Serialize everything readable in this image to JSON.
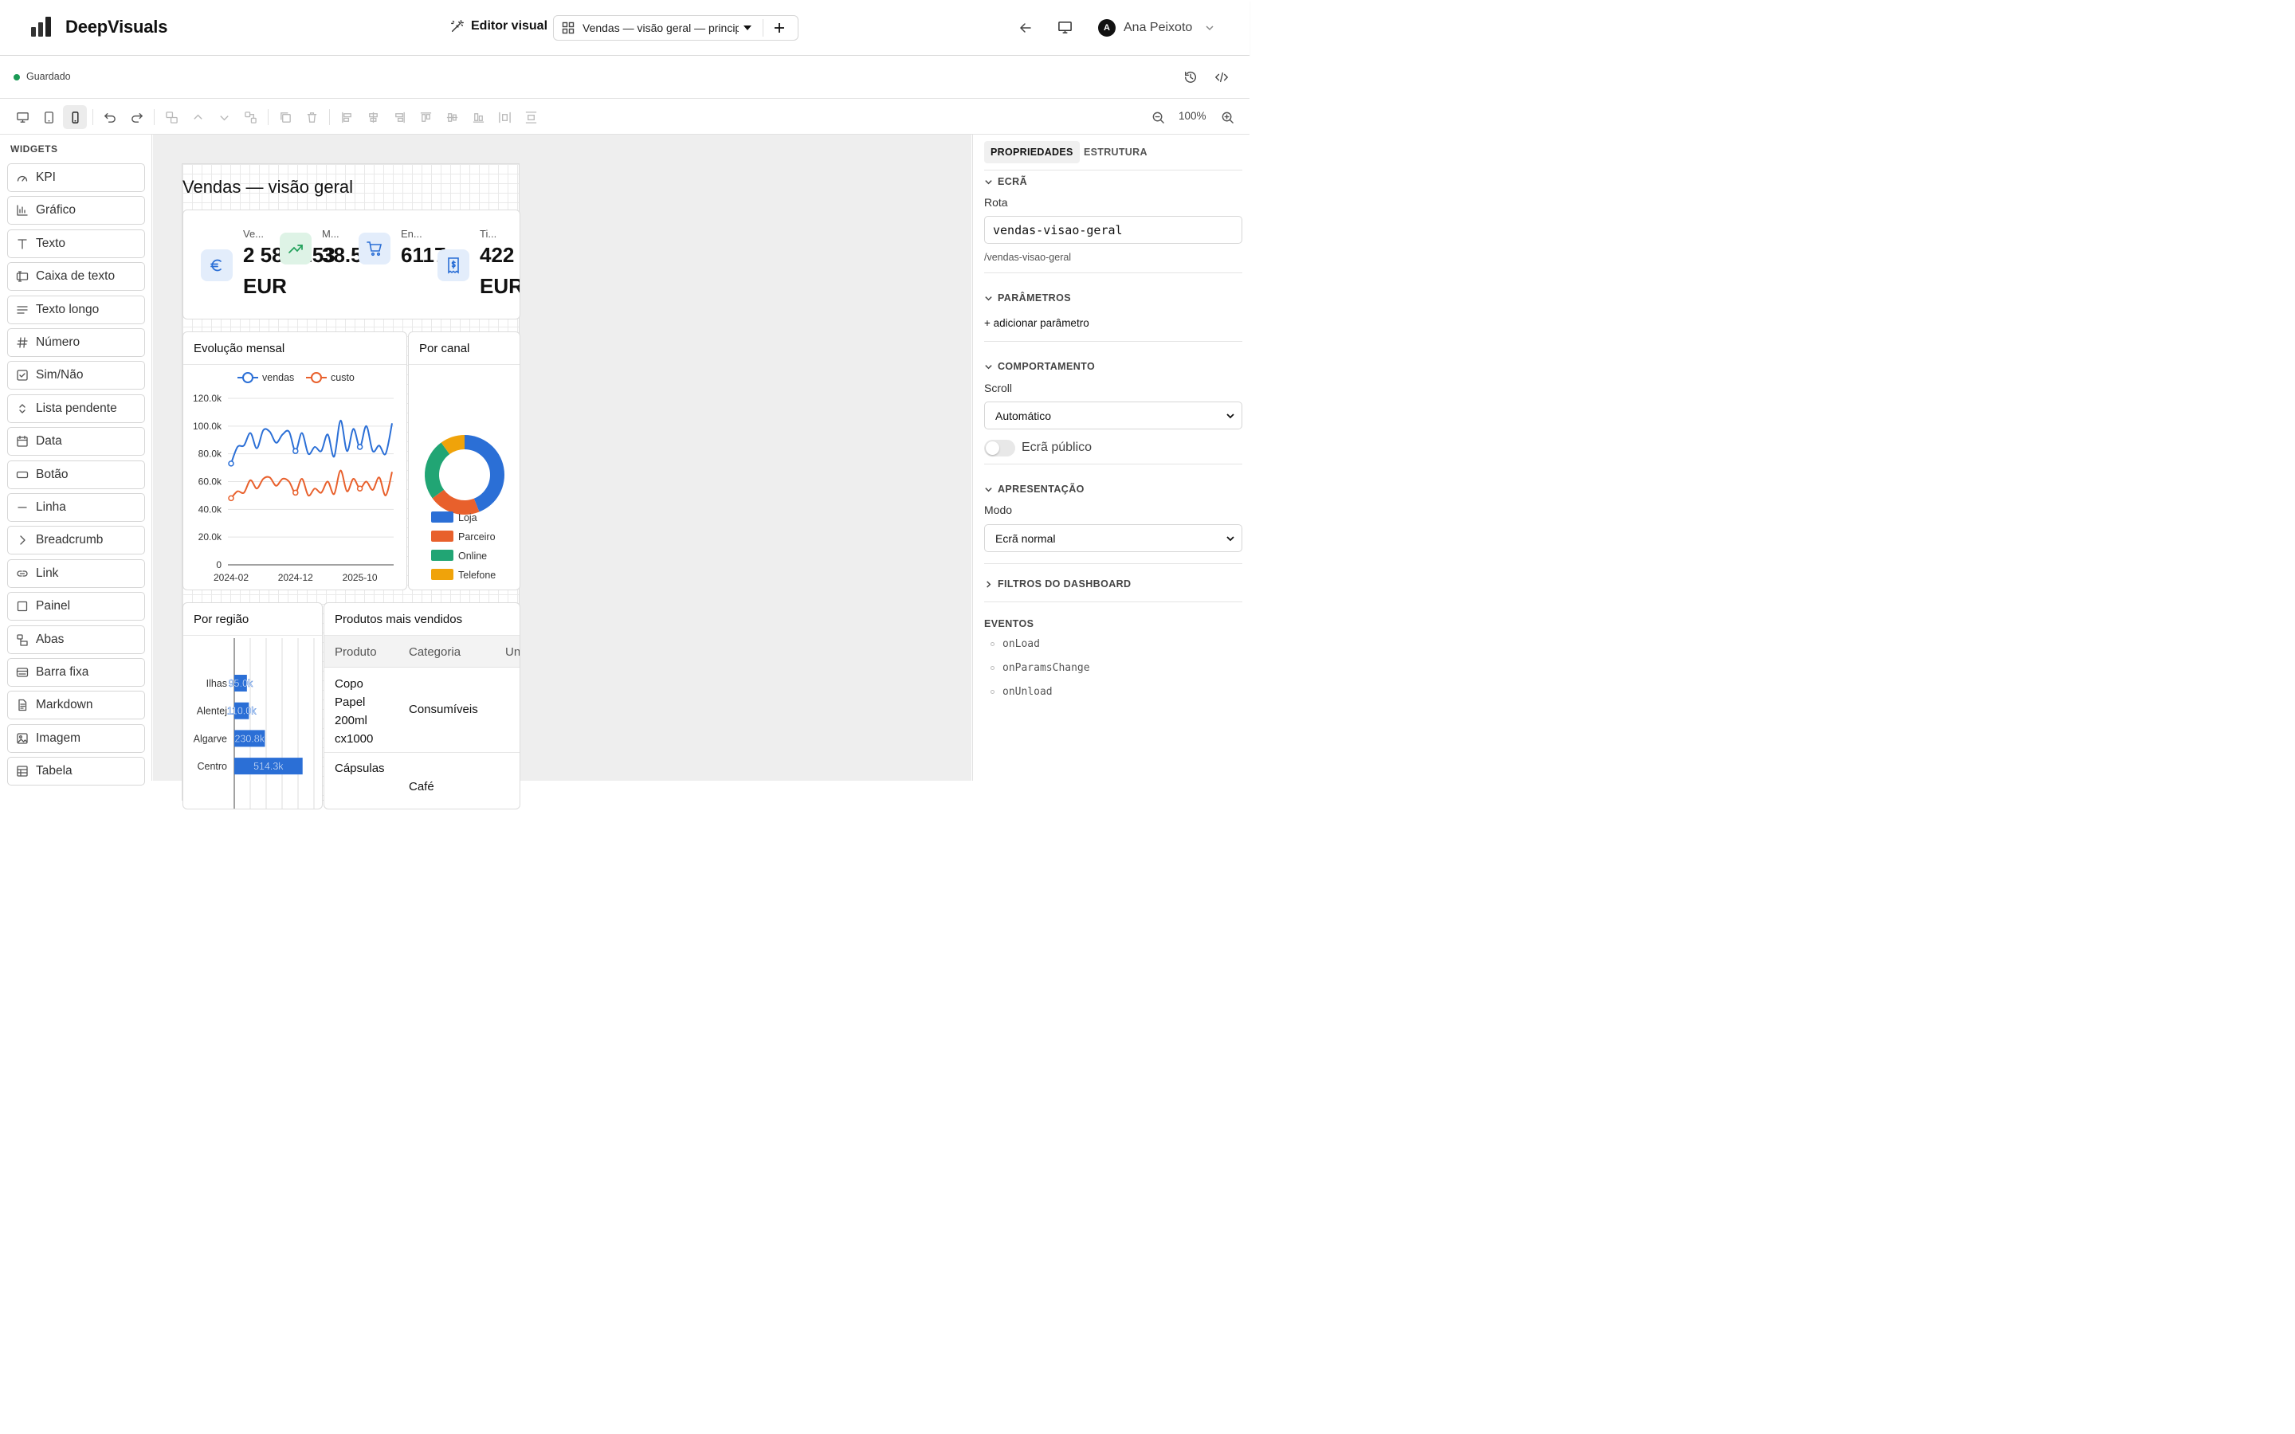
{
  "app": {
    "name": "DeepVisuals"
  },
  "header": {
    "mode_label": "Editor visual",
    "screen_select_value": "Vendas — visão geral — princip",
    "user_initial": "A",
    "user_name": "Ana Peixoto"
  },
  "status": {
    "label": "Guardado",
    "color": "#1a9a55"
  },
  "toolbar": {
    "zoom": "100%"
  },
  "sidebar": {
    "title": "WIDGETS",
    "items": [
      {
        "label": "KPI",
        "icon": "gauge-icon"
      },
      {
        "label": "Gráfico",
        "icon": "bar-chart-icon"
      },
      {
        "label": "Texto",
        "icon": "text-icon"
      },
      {
        "label": "Caixa de texto",
        "icon": "text-input-icon"
      },
      {
        "label": "Texto longo",
        "icon": "paragraph-icon"
      },
      {
        "label": "Número",
        "icon": "hash-icon"
      },
      {
        "label": "Sim/Não",
        "icon": "checkbox-icon"
      },
      {
        "label": "Lista pendente",
        "icon": "chevrons-updown-icon"
      },
      {
        "label": "Data",
        "icon": "calendar-icon"
      },
      {
        "label": "Botão",
        "icon": "button-icon"
      },
      {
        "label": "Linha",
        "icon": "line-icon"
      },
      {
        "label": "Breadcrumb",
        "icon": "chevron-right-icon"
      },
      {
        "label": "Link",
        "icon": "link-icon"
      },
      {
        "label": "Painel",
        "icon": "square-icon"
      },
      {
        "label": "Abas",
        "icon": "tabs-icon"
      },
      {
        "label": "Barra fixa",
        "icon": "fixed-bar-icon"
      },
      {
        "label": "Markdown",
        "icon": "document-icon"
      },
      {
        "label": "Imagem",
        "icon": "image-icon"
      },
      {
        "label": "Tabela",
        "icon": "table-icon"
      }
    ]
  },
  "canvas": {
    "page_title": "Vendas — visão geral",
    "kpis": [
      {
        "label": "Ve...",
        "value_line1": "2 584 253",
        "value_line2": "EUR",
        "icon": "euro-icon",
        "icon_color": "#2b6fd6",
        "icon_bg": "#e3edfb"
      },
      {
        "label": "M...",
        "value_line1": "38.5%",
        "value_line2": "",
        "icon": "trending-up-icon",
        "icon_color": "#21a05a",
        "icon_bg": "#def3e6"
      },
      {
        "label": "En...",
        "value_line1": "6117",
        "value_line2": "",
        "icon": "cart-icon",
        "icon_color": "#2b6fd6",
        "icon_bg": "#e3edfb"
      },
      {
        "label": "Ti...",
        "value_line1": "422",
        "value_line2": "EUR",
        "icon": "receipt-icon",
        "icon_color": "#2b6fd6",
        "icon_bg": "#e3edfb"
      }
    ],
    "line_card_title": "Evolução mensal",
    "pie_card_title": "Por canal",
    "bar_card_title": "Por região",
    "table_card_title": "Produtos mais vendidos",
    "table": {
      "columns": [
        "Produto",
        "Categoria",
        "Un"
      ],
      "rows": [
        {
          "produto": [
            "Copo",
            "Papel",
            "200ml",
            "cx1000"
          ],
          "categoria": "Consumíveis"
        },
        {
          "produto": [
            "Cápsulas"
          ],
          "categoria": "Café"
        }
      ]
    }
  },
  "chart_data": [
    {
      "type": "line",
      "x": [
        "2024-02",
        "2024-03",
        "2024-04",
        "2024-05",
        "2024-06",
        "2024-07",
        "2024-08",
        "2024-09",
        "2024-10",
        "2024-11",
        "2024-12",
        "2025-01",
        "2025-02",
        "2025-03",
        "2025-04",
        "2025-05",
        "2025-06",
        "2025-07",
        "2025-08",
        "2025-09",
        "2025-10",
        "2025-11",
        "2025-12",
        "2026-01",
        "2026-02",
        "2026-03"
      ],
      "xticks": [
        "2024-02",
        "2024-12",
        "2025-10"
      ],
      "yticks": [
        "0",
        "20.0k",
        "40.0k",
        "60.0k",
        "80.0k",
        "100.0k",
        "120.0k"
      ],
      "ylim": [
        0,
        120000
      ],
      "series": [
        {
          "name": "vendas",
          "color": "#2b6fd6",
          "values": [
            73000,
            85000,
            86000,
            95000,
            84000,
            97000,
            96000,
            88000,
            94000,
            96000,
            82000,
            95000,
            80000,
            85000,
            82000,
            94000,
            78000,
            104000,
            82000,
            98000,
            85000,
            100000,
            82000,
            86000,
            80000,
            102000
          ]
        },
        {
          "name": "custo",
          "color": "#e8602c",
          "values": [
            48000,
            53000,
            52000,
            61000,
            55000,
            62000,
            63000,
            57000,
            62000,
            60000,
            52000,
            62000,
            50000,
            55000,
            52000,
            60000,
            51000,
            68000,
            53000,
            62000,
            55000,
            60000,
            54000,
            63000,
            50000,
            67000
          ]
        }
      ],
      "markers": {
        "vendas": [
          0,
          10,
          20
        ],
        "custo": [
          0,
          10,
          20
        ]
      }
    },
    {
      "type": "pie",
      "donut": true,
      "slices": [
        {
          "name": "Loja",
          "value": 44,
          "color": "#2b6fd6"
        },
        {
          "name": "Parceiro",
          "value": 21,
          "color": "#e8602c"
        },
        {
          "name": "Online",
          "value": 25,
          "color": "#21a574"
        },
        {
          "name": "Telefone",
          "value": 10,
          "color": "#f0a30a"
        }
      ]
    },
    {
      "type": "bar",
      "orientation": "horizontal",
      "categories": [
        "Ilhas",
        "Alentejo",
        "Algarve",
        "Centro"
      ],
      "tick_labels": [
        "Ilhas",
        "Alentej",
        "Algarve",
        "Centro"
      ],
      "values": [
        95000,
        110000,
        230800,
        514300
      ],
      "data_labels": [
        "95.0k",
        "110.0k",
        "230.8k",
        "514.3k"
      ],
      "color": "#2b6fd6"
    }
  ],
  "right_panel": {
    "tabs": [
      "PROPRIEDADES",
      "ESTRUTURA"
    ],
    "screen_section": "ECRÃ",
    "route_label": "Rota",
    "route_value": "vendas-visao-geral",
    "route_path": "/vendas-visao-geral",
    "params_section": "PARÂMETROS",
    "add_param": "+ adicionar parâmetro",
    "behavior_section": "COMPORTAMENTO",
    "scroll_label": "Scroll",
    "scroll_value": "Automático",
    "public_label": "Ecrã público",
    "public_on": false,
    "presentation_section": "APRESENTAÇÃO",
    "mode_label": "Modo",
    "mode_value": "Ecrã normal",
    "filters_section": "FILTROS DO DASHBOARD",
    "events_section": "EVENTOS",
    "events": [
      "onLoad",
      "onParamsChange",
      "onUnload"
    ]
  }
}
